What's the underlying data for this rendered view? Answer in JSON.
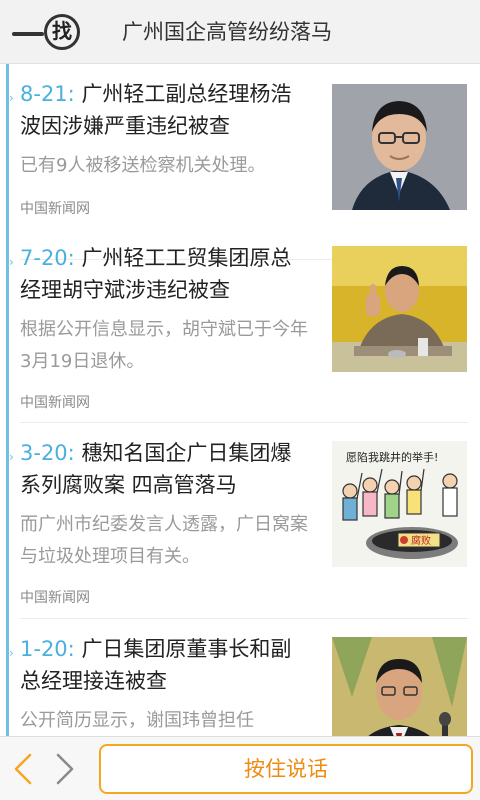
{
  "header": {
    "logo_text": "找",
    "logo_icon": "find-logo-icon",
    "title": "广州国企高管纷纷落马"
  },
  "colors": {
    "accent_blue": "#4ab0de",
    "timeline_blue": "#6ec1e4",
    "action_orange": "#f08a10"
  },
  "feed": {
    "items": [
      {
        "date": "8-21:",
        "title": "广州轻工副总经理杨浩波因涉嫌严重违纪被查",
        "summary": "已有9人被移送检察机关处理。",
        "source": "中国新闻网",
        "thumbnail": "man-with-glasses-portrait"
      },
      {
        "date": "7-20:",
        "title": "广州轻工工贸集团原总经理胡守斌涉违纪被查",
        "summary": "根据公开信息显示，胡守斌已于今年3月19日退休。",
        "source": "中国新闻网",
        "thumbnail": "man-thumbs-up-at-desk"
      },
      {
        "date": "3-20:",
        "title": "穗知名国企广日集团爆系列腐败案 四高管落马",
        "summary": "而广州市纪委发言人透露，广日窝案与垃圾处理项目有关。",
        "source": "中国新闻网",
        "thumbnail": "corruption-cartoon",
        "cartoon_caption": "愿陷我跳井的举手!",
        "cartoon_label": "腐败"
      },
      {
        "date": "1-20:",
        "title": "广日集团原董事长和副总经理接连被查",
        "summary": "公开简历显示，谢国玮曾担任",
        "source": "",
        "thumbnail": "man-speaking-at-microphone"
      }
    ]
  },
  "bottom_bar": {
    "back_icon": "chevron-left-icon",
    "forward_icon": "chevron-right-icon",
    "talk_label": "按住说话"
  }
}
